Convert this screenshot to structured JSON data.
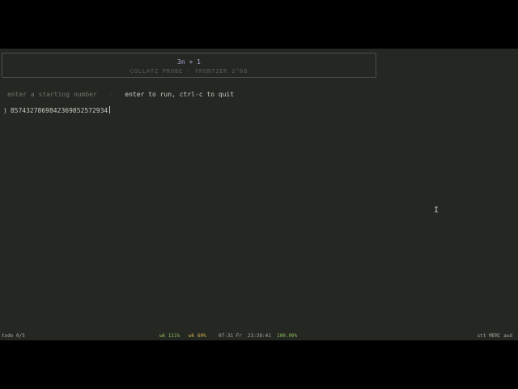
{
  "banner": {
    "title": "3n + 1",
    "subtitle": "COLLATZ PROBE  ·  FRONTIER 2^68"
  },
  "hint": {
    "label": "enter a starting number",
    "separator": "·",
    "keys": "enter to run, ctrl-c to quit"
  },
  "prompt": {
    "symbol": ")",
    "value": "8574327869842369852572934"
  },
  "status": {
    "left": "todo 0/5",
    "wk1": "wk 111%",
    "wk2": "wk 60%",
    "date": "07-31 Fr",
    "time": "23:28:41",
    "battery": "100.00%",
    "right": "stt MERC aud"
  },
  "colors": {
    "background": "#242722",
    "accent_title": "#a9a8d8",
    "status_green": "#8fbf5a",
    "status_yellow": "#d2b44e"
  },
  "icons": {
    "mouse_cursor": "text-cursor-icon"
  }
}
